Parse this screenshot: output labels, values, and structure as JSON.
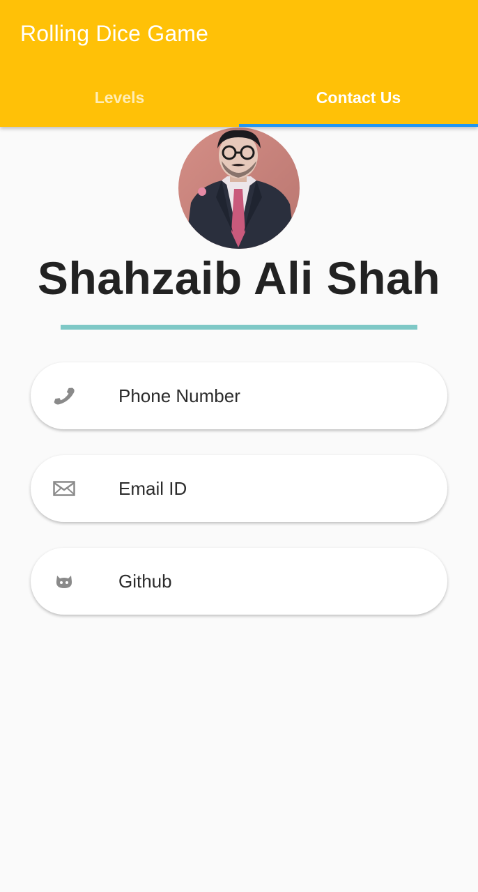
{
  "app": {
    "title": "Rolling Dice Game",
    "accent_color": "#ffc107",
    "tab_indicator_color": "#2196f3"
  },
  "tabs": [
    {
      "label": "Levels",
      "active": false
    },
    {
      "label": "Contact Us",
      "active": true
    }
  ],
  "profile": {
    "name": "Shahzaib Ali Shah",
    "divider_color": "#7ec8c6"
  },
  "contacts": [
    {
      "label": "Phone Number",
      "icon": "phone-icon"
    },
    {
      "label": "Email ID",
      "icon": "mail-icon"
    },
    {
      "label": "Github",
      "icon": "github-icon"
    }
  ]
}
